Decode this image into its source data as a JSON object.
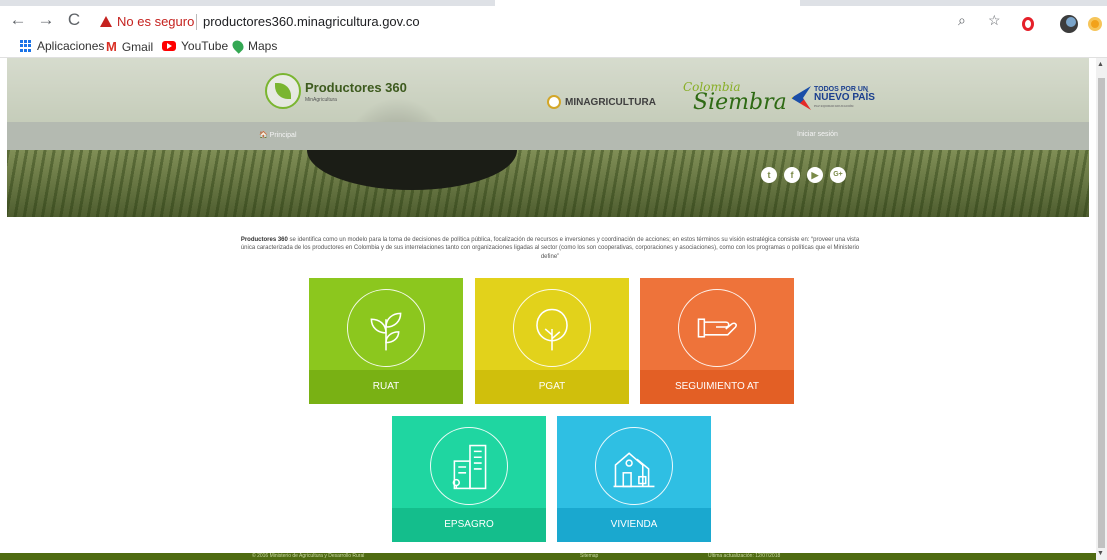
{
  "browser": {
    "security_label": "No es seguro",
    "url": "productores360.minagricultura.gov.co",
    "bookmarks": [
      {
        "label": "Aplicaciones",
        "icon": "apps-grid-icon"
      },
      {
        "label": "Gmail",
        "icon": "gmail-icon"
      },
      {
        "label": "YouTube",
        "icon": "youtube-icon"
      },
      {
        "label": "Maps",
        "icon": "maps-icon"
      }
    ]
  },
  "header": {
    "logo_title": "Productores 360",
    "logo_subtitle": "MinAgricultura",
    "ministry": "MINAGRICULTURA",
    "colombia_line1": "Colombia",
    "colombia_line2": "Siembra",
    "todos_line1": "TODOS POR UN",
    "todos_line2": "NUEVO PAÍS",
    "todos_line3": "PAZ  EQUIDAD  EDUCACIÓN"
  },
  "menu": {
    "home": "🏠 Principal",
    "login": "Iniciar sesión"
  },
  "social": [
    "twitter-icon",
    "facebook-icon",
    "youtube-icon",
    "google-plus-icon"
  ],
  "intro": {
    "bold": "Productores 360",
    "text": " se identifica como un modelo para la toma de decisiones de política pública, focalización de recursos e inversiones y coordinación de acciones; en estos términos su visión estratégica consiste en: “proveer una vista única caracterizada de los productores en Colombia y de sus interrelaciones tanto con organizaciones ligadas al sector (como los son cooperativas, corporaciones y asociaciones), como con los programas o políticas que el Ministerio define”"
  },
  "cards": [
    {
      "label": "RUAT",
      "icon": "sprout-icon",
      "color": "#8cc71e",
      "foot": "#79b114"
    },
    {
      "label": "PGAT",
      "icon": "tree-icon",
      "color": "#e2d21b",
      "foot": "#d0bf0c"
    },
    {
      "label": "SEGUIMIENTO AT",
      "icon": "hand-icon",
      "color": "#ee733a",
      "foot": "#e35f25"
    },
    {
      "label": "EPSAGRO",
      "icon": "buildings-icon",
      "color": "#1fd6a1",
      "foot": "#14be8c"
    },
    {
      "label": "VIVIENDA",
      "icon": "house-icon",
      "color": "#2fbfe3",
      "foot": "#1aa8cf"
    }
  ],
  "footer": {
    "copyright": "© 2016 Ministerio de Agricultura y Desarrollo Rural",
    "middle": "Sitemap",
    "updated": "Última actualización: 12/07/2018"
  }
}
